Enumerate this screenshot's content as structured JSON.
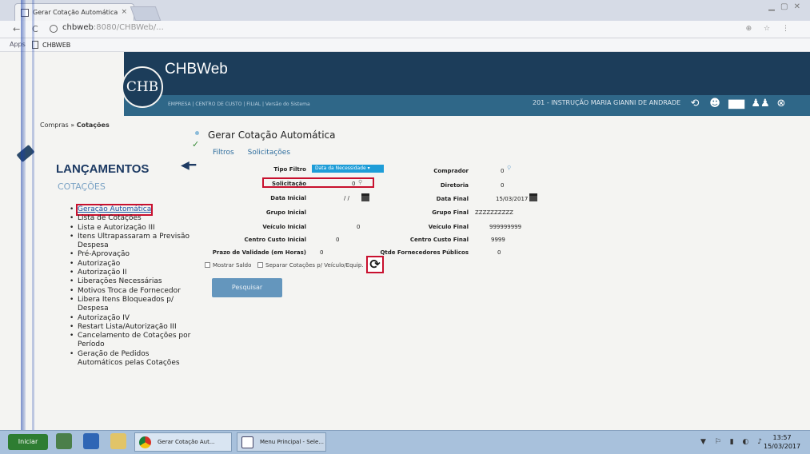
{
  "browser": {
    "tab_title": "Gerar Cotação Automática",
    "tab_close": "×",
    "url_host": "chbweb",
    "url_rest": ":8080/CHBWeb/...",
    "bookmark_apps": "Apps",
    "bookmark_label": "CHBWEB"
  },
  "header": {
    "logo_text": "CHB",
    "app_title": "CHBWeb",
    "empresa_info": "EMPRESA | CENTRO DE CUSTO | FILIAL | Versão do Sistema",
    "user_info": "201 - INSTRUÇÃO MARIA GIANNI DE ANDRADE"
  },
  "breadcrumb": {
    "path": "Compras » ",
    "current": "Cotações"
  },
  "sidebar": {
    "title": "LANÇAMENTOS",
    "subtitle": "COTAÇÕES",
    "items": [
      "Geração Automática",
      "Lista de Cotações",
      "Lista e Autorização III",
      "Itens Ultrapassaram a Previsão Despesa",
      "Pré-Aprovação",
      "Autorização",
      "Autorização II",
      "Liberações Necessárias",
      "Motivos Troca de Fornecedor",
      "Libera Itens Bloqueados p/ Despesa",
      "Autorização IV",
      "Restart Lista/Autorização III",
      "Cancelamento de Cotações por Período",
      "Geração de Pedidos Automáticos pelas Cotações"
    ]
  },
  "main": {
    "page_title": "Gerar Cotação Automática",
    "tabs": [
      "Filtros",
      "Solicitações"
    ],
    "form": {
      "tipo_filtro_label": "Tipo Filtro",
      "tipo_filtro_value": "Data da Necessidade",
      "solicitacao_label": "Solicitação",
      "solicitacao_value": "0",
      "data_inicial_label": "Data Inicial",
      "data_inicial_value": "/ /",
      "grupo_inicial_label": "Grupo Inicial",
      "veiculo_inicial_label": "Veículo Inicial",
      "veiculo_inicial_value": "0",
      "centro_custo_inicial_label": "Centro Custo Inicial",
      "centro_custo_inicial_value": "0",
      "prazo_validade_label": "Prazo de Validade (em Horas)",
      "prazo_validade_value": "0",
      "comprador_label": "Comprador",
      "comprador_value": "0",
      "diretoria_label": "Diretoria",
      "diretoria_value": "0",
      "data_final_label": "Data Final",
      "data_final_value": "15/03/2017",
      "grupo_final_label": "Grupo Final",
      "grupo_final_value": "ZZZZZZZZZZ",
      "veiculo_final_label": "Veículo Final",
      "veiculo_final_value": "999999999",
      "centro_custo_final_label": "Centro Custo Final",
      "centro_custo_final_value": "9999",
      "qtde_fornecedores_label": "Qtde Fornecedores Públicos",
      "qtde_fornecedores_value": "0",
      "mostrar_saldo_label": "Mostrar Saldo",
      "separar_cotacoes_label": "Separar Cotações p/ Veículo/Equip."
    },
    "search_button": "Pesquisar"
  },
  "taskbar": {
    "start_label": "Iniciar",
    "tasks": [
      "Gerar Cotação Aut...",
      "Menu Principal - Sele..."
    ],
    "time": "13:57",
    "date": "15/03/2017"
  }
}
